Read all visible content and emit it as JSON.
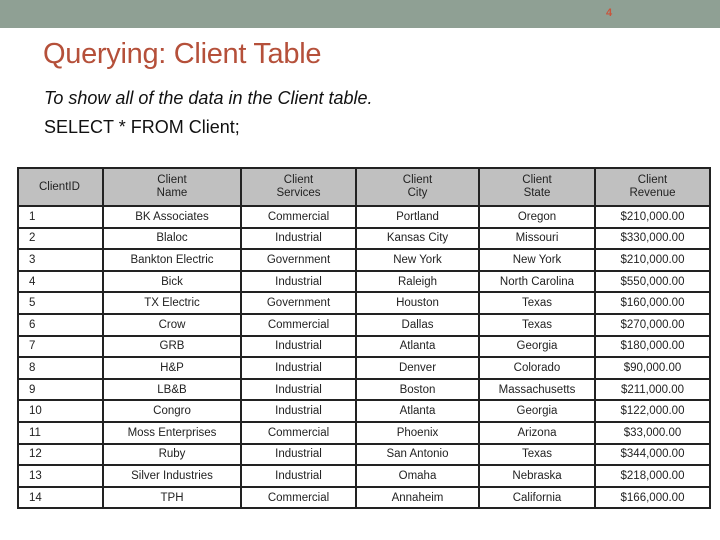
{
  "slide": {
    "number": "4",
    "title": "Querying: Client Table",
    "subtitle": "To show all of the data in the Client table.",
    "query": "SELECT * FROM Client;"
  },
  "colors": {
    "topbar": "#8fa094",
    "title": "#b5503a",
    "header_bg": "#c0c0c0"
  },
  "table": {
    "headers": [
      [
        "ClientID",
        ""
      ],
      [
        "Client",
        "Name"
      ],
      [
        "Client",
        "Services"
      ],
      [
        "Client",
        "City"
      ],
      [
        "Client",
        "State"
      ],
      [
        "Client",
        "Revenue"
      ]
    ],
    "rows": [
      [
        "1",
        "BK Associates",
        "Commercial",
        "Portland",
        "Oregon",
        "$210,000.00"
      ],
      [
        "2",
        "Blaloc",
        "Industrial",
        "Kansas City",
        "Missouri",
        "$330,000.00"
      ],
      [
        "3",
        "Bankton Electric",
        "Government",
        "New York",
        "New York",
        "$210,000.00"
      ],
      [
        "4",
        "Bick",
        "Industrial",
        "Raleigh",
        "North Carolina",
        "$550,000.00"
      ],
      [
        "5",
        "TX Electric",
        "Government",
        "Houston",
        "Texas",
        "$160,000.00"
      ],
      [
        "6",
        "Crow",
        "Commercial",
        "Dallas",
        "Texas",
        "$270,000.00"
      ],
      [
        "7",
        "GRB",
        "Industrial",
        "Atlanta",
        "Georgia",
        "$180,000.00"
      ],
      [
        "8",
        "H&P",
        "Industrial",
        "Denver",
        "Colorado",
        "$90,000.00"
      ],
      [
        "9",
        "LB&B",
        "Industrial",
        "Boston",
        "Massachusetts",
        "$211,000.00"
      ],
      [
        "10",
        "Congro",
        "Industrial",
        "Atlanta",
        "Georgia",
        "$122,000.00"
      ],
      [
        "11",
        "Moss Enterprises",
        "Commercial",
        "Phoenix",
        "Arizona",
        "$33,000.00"
      ],
      [
        "12",
        "Ruby",
        "Industrial",
        "San Antonio",
        "Texas",
        "$344,000.00"
      ],
      [
        "13",
        "Silver Industries",
        "Industrial",
        "Omaha",
        "Nebraska",
        "$218,000.00"
      ],
      [
        "14",
        "TPH",
        "Commercial",
        "Annaheim",
        "California",
        "$166,000.00"
      ]
    ]
  }
}
